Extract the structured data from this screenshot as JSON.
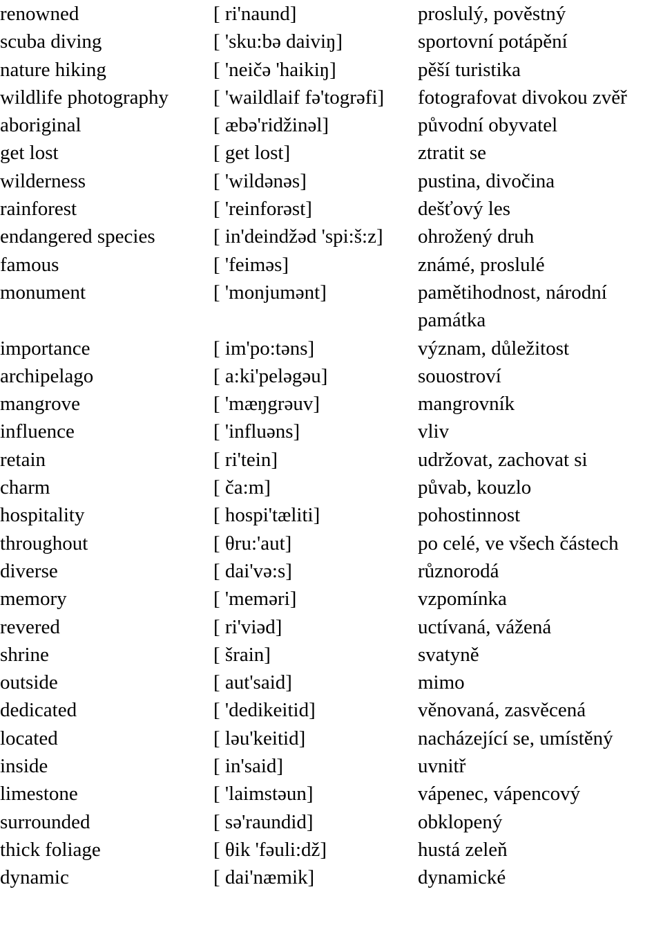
{
  "document": {
    "type": "vocabulary-list",
    "language_pair": "English – Czech",
    "columns": [
      "term",
      "pronunciation",
      "translation"
    ],
    "entries": [
      {
        "term": "renowned",
        "pron": "[ ri'naund]",
        "trans": "proslulý, pověstný"
      },
      {
        "term": "scuba diving",
        "pron": "[ 'sku:bə daiviŋ]",
        "trans": "sportovní potápění"
      },
      {
        "term": "nature hiking",
        "pron": "[ 'neičə 'haikiŋ]",
        "trans": "pěší turistika"
      },
      {
        "term": "wildlife photography",
        "pron": "[ 'waildlaif fə'togrəfi]",
        "trans": "fotografovat divokou zvěř"
      },
      {
        "term": "aboriginal",
        "pron": "[ æbə'ridžinəl]",
        "trans": "původní obyvatel"
      },
      {
        "term": "get lost",
        "pron": "[ get lost]",
        "trans": "ztratit se"
      },
      {
        "term": "wilderness",
        "pron": "[ 'wildənəs]",
        "trans": "pustina, divočina"
      },
      {
        "term": "rainforest",
        "pron": "[ 'reinforəst]",
        "trans": "dešťový les"
      },
      {
        "term": "endangered species",
        "pron": "[ in'deindžəd 'spi:š:z]",
        "trans": "ohrožený druh"
      },
      {
        "term": "famous",
        "pron": "[ 'feiməs]",
        "trans": "známé, proslulé"
      },
      {
        "term": "monument",
        "pron": "[ 'monjumənt]",
        "trans": "pamětihodnost, národní památka"
      },
      {
        "term": "importance",
        "pron": "[ im'po:təns]",
        "trans": "význam, důležitost"
      },
      {
        "term": "archipelago",
        "pron": "[ a:ki'peləgəu]",
        "trans": "souostroví"
      },
      {
        "term": "mangrove",
        "pron": "[ 'mæŋgrəuv]",
        "trans": "mangrovník"
      },
      {
        "term": "influence",
        "pron": "[ 'influəns]",
        "trans": "vliv"
      },
      {
        "term": "retain",
        "pron": "[ ri'tein]",
        "trans": "udržovat, zachovat si"
      },
      {
        "term": "charm",
        "pron": "[ ča:m]",
        "trans": "půvab, kouzlo"
      },
      {
        "term": "hospitality",
        "pron": "[ hospi'tæliti]",
        "trans": "pohostinnost"
      },
      {
        "term": "throughout",
        "pron": "[ θru:'aut]",
        "trans": "po celé, ve všech částech"
      },
      {
        "term": "diverse",
        "pron": "[ dai'və:s]",
        "trans": "různorodá"
      },
      {
        "term": "memory",
        "pron": "[ 'meməri]",
        "trans": "vzpomínka"
      },
      {
        "term": "revered",
        "pron": "[ ri'viəd]",
        "trans": "uctívaná, vážená"
      },
      {
        "term": "shrine",
        "pron": "[ šrain]",
        "trans": "svatyně"
      },
      {
        "term": "outside",
        "pron": "[ aut'said]",
        "trans": "mimo"
      },
      {
        "term": "dedicated",
        "pron": "[ 'dedikeitid]",
        "trans": "věnovaná, zasvěcená"
      },
      {
        "term": "located",
        "pron": "[ ləu'keitid]",
        "trans": "nacházející se, umístěný"
      },
      {
        "term": "inside",
        "pron": "[ in'said]",
        "trans": "uvnitř"
      },
      {
        "term": "limestone",
        "pron": "[ 'laimstəun]",
        "trans": "vápenec, vápencový"
      },
      {
        "term": "surrounded",
        "pron": "[ sə'raundid]",
        "trans": "obklopený"
      },
      {
        "term": "thick foliage",
        "pron": "[ θik 'fəuli:dž]",
        "trans": "hustá zeleň"
      },
      {
        "term": "dynamic",
        "pron": "[ dai'næmik]",
        "trans": "dynamické"
      }
    ]
  }
}
